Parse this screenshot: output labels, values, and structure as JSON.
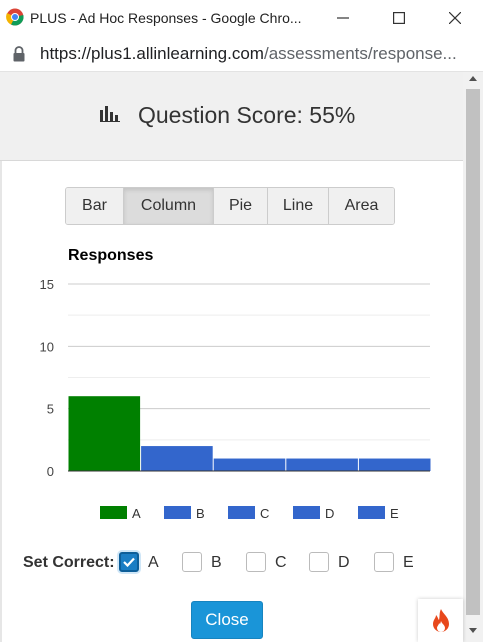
{
  "window": {
    "title": "PLUS - Ad Hoc Responses - Google Chro..."
  },
  "address": {
    "host": "https://plus1.allinlearning.com",
    "path": "/assessments/response..."
  },
  "header": {
    "score_title": "Question Score: 55%"
  },
  "tabs": [
    {
      "label": "Bar",
      "active": false
    },
    {
      "label": "Column",
      "active": true
    },
    {
      "label": "Pie",
      "active": false
    },
    {
      "label": "Line",
      "active": false
    },
    {
      "label": "Area",
      "active": false
    }
  ],
  "chart_data": {
    "type": "bar",
    "title": "Responses",
    "categories": [
      "A",
      "B",
      "C",
      "D",
      "E"
    ],
    "values": [
      6,
      2,
      1,
      1,
      1
    ],
    "colors": [
      "#008000",
      "#3366cc",
      "#3366cc",
      "#3366cc",
      "#3366cc"
    ],
    "ylim": [
      0,
      15
    ],
    "yticks": [
      0,
      5,
      10,
      15
    ],
    "grid": true,
    "legend_position": "bottom",
    "xlabel": "",
    "ylabel": ""
  },
  "set_correct": {
    "label": "Set Correct:",
    "options": [
      {
        "label": "A",
        "checked": true
      },
      {
        "label": "B",
        "checked": false
      },
      {
        "label": "C",
        "checked": false
      },
      {
        "label": "D",
        "checked": false
      },
      {
        "label": "E",
        "checked": false
      }
    ]
  },
  "close_button": {
    "label": "Close"
  },
  "colors": {
    "correct": "#008000",
    "incorrect": "#3366cc",
    "primary_button": "#1a95d8"
  }
}
